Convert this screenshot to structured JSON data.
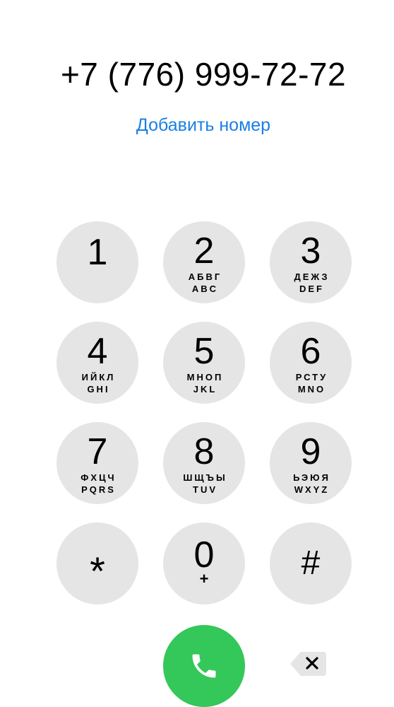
{
  "display": {
    "number": "+7 (776) 999-72-72",
    "add_number_label": "Добавить номер"
  },
  "keypad": {
    "keys": [
      {
        "digit": "1",
        "letters_ru": "",
        "letters_en": ""
      },
      {
        "digit": "2",
        "letters_ru": "АБВГ",
        "letters_en": "ABC"
      },
      {
        "digit": "3",
        "letters_ru": "ДЕЖЗ",
        "letters_en": "DEF"
      },
      {
        "digit": "4",
        "letters_ru": "ИЙКЛ",
        "letters_en": "GHI"
      },
      {
        "digit": "5",
        "letters_ru": "МНОП",
        "letters_en": "JKL"
      },
      {
        "digit": "6",
        "letters_ru": "РСТУ",
        "letters_en": "MNO"
      },
      {
        "digit": "7",
        "letters_ru": "ФХЦЧ",
        "letters_en": "PQRS"
      },
      {
        "digit": "8",
        "letters_ru": "ШЩЪЫ",
        "letters_en": "TUV"
      },
      {
        "digit": "9",
        "letters_ru": "ЬЭЮЯ",
        "letters_en": "WXYZ"
      },
      {
        "digit": "*"
      },
      {
        "digit": "0",
        "plus": "+"
      },
      {
        "digit": "#"
      }
    ]
  },
  "actions": {
    "call_icon": "phone-icon",
    "delete_icon": "backspace-icon"
  },
  "colors": {
    "accent_blue": "#1a7fe6",
    "call_green": "#34c759",
    "key_gray": "#e5e5e5"
  }
}
